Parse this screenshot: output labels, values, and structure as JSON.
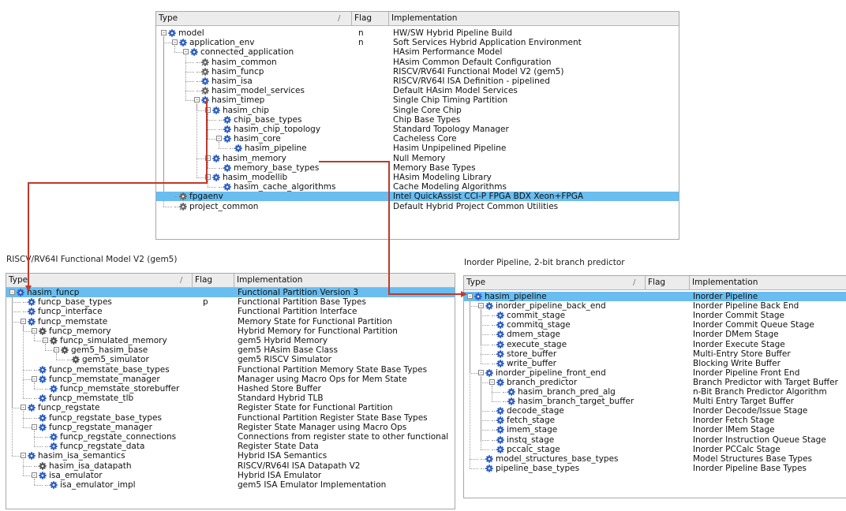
{
  "columns": {
    "type": "Type",
    "flag": "Flag",
    "impl": "Implementation",
    "sort_indicator": "/"
  },
  "colors": {
    "selection": "#69bdf0",
    "arrow": "#c0392b",
    "icon_blue": "#2d5fc4"
  },
  "top_panel": {
    "rows": [
      {
        "depth": 0,
        "icon": "gear-icon",
        "exp": "-",
        "label": "model",
        "flag": "n",
        "impl": "HW/SW Hybrid Pipeline Build"
      },
      {
        "depth": 1,
        "icon": "gear-icon",
        "exp": "-",
        "label": "application_env",
        "flag": "n",
        "impl": "Soft Services Hybrid Application Environment"
      },
      {
        "depth": 2,
        "icon": "gear-icon",
        "exp": "-",
        "label": "connected_application",
        "flag": "",
        "impl": "HAsim Performance Model"
      },
      {
        "depth": 3,
        "icon": "link-gear-icon",
        "exp": "",
        "label": "hasim_common",
        "flag": "",
        "impl": "HAsim Common Default Configuration"
      },
      {
        "depth": 3,
        "icon": "link-gear-icon",
        "exp": "",
        "label": "hasim_funcp",
        "flag": "",
        "impl": "RISCV/RV64I Functional Model V2 (gem5)"
      },
      {
        "depth": 3,
        "icon": "gear-icon",
        "exp": "",
        "label": "hasim_isa",
        "flag": "",
        "impl": "RISCV/RV64I ISA Definition - pipelined"
      },
      {
        "depth": 3,
        "icon": "link-gear-icon",
        "exp": "",
        "label": "hasim_model_services",
        "flag": "",
        "impl": "Default HAsim Model Services"
      },
      {
        "depth": 3,
        "icon": "gear-icon",
        "exp": "-",
        "label": "hasim_timep",
        "flag": "",
        "impl": "Single Chip Timing Partition"
      },
      {
        "depth": 4,
        "icon": "gear-icon",
        "exp": "-",
        "label": "hasim_chip",
        "flag": "",
        "impl": "Single Core Chip"
      },
      {
        "depth": 5,
        "icon": "gear-icon",
        "exp": "",
        "label": "chip_base_types",
        "flag": "",
        "impl": "Chip Base Types"
      },
      {
        "depth": 5,
        "icon": "gear-icon",
        "exp": "",
        "label": "hasim_chip_topology",
        "flag": "",
        "impl": "Standard Topology Manager"
      },
      {
        "depth": 5,
        "icon": "gear-icon",
        "exp": "-",
        "label": "hasim_core",
        "flag": "",
        "impl": "Cacheless Core"
      },
      {
        "depth": 6,
        "icon": "gear-icon",
        "exp": "",
        "label": "hasim_pipeline",
        "flag": "",
        "impl": "Hasim Unpipelined Pipeline"
      },
      {
        "depth": 4,
        "icon": "gear-icon",
        "exp": "-",
        "label": "hasim_memory",
        "flag": "",
        "impl": "Null Memory"
      },
      {
        "depth": 5,
        "icon": "gear-icon",
        "exp": "",
        "label": "memory_base_types",
        "flag": "",
        "impl": "Memory Base Types"
      },
      {
        "depth": 4,
        "icon": "gear-icon",
        "exp": "-",
        "label": "hasim_modellib",
        "flag": "",
        "impl": "HAsim Modeling Library"
      },
      {
        "depth": 5,
        "icon": "gear-icon",
        "exp": "",
        "label": "hasim_cache_algorithms",
        "flag": "",
        "impl": "Cache Modeling Algorithms"
      },
      {
        "depth": 1,
        "icon": "link-gear-icon",
        "exp": "",
        "label": "fpgaenv",
        "flag": "",
        "impl": "Intel QuickAssist CCI-P FPGA BDX Xeon+FPGA",
        "selected": true
      },
      {
        "depth": 1,
        "icon": "link-gear-icon",
        "exp": "",
        "label": "project_common",
        "flag": "",
        "impl": "Default Hybrid Project Common Utilities"
      }
    ]
  },
  "left_panel": {
    "title": "RISCV/RV64I Functional Model V2 (gem5)",
    "rows": [
      {
        "depth": 0,
        "icon": "gear-icon",
        "exp": "-",
        "label": "hasim_funcp",
        "flag": "",
        "impl": "Functional Partition Version 3",
        "selected": true
      },
      {
        "depth": 1,
        "icon": "gear-icon",
        "exp": "",
        "label": "funcp_base_types",
        "flag": "p",
        "impl": "Functional Partition Base Types"
      },
      {
        "depth": 1,
        "icon": "gear-icon",
        "exp": "",
        "label": "funcp_interface",
        "flag": "",
        "impl": "Functional Partition Interface"
      },
      {
        "depth": 1,
        "icon": "gear-icon",
        "exp": "-",
        "label": "funcp_memstate",
        "flag": "",
        "impl": "Memory State for Functional Partition"
      },
      {
        "depth": 2,
        "icon": "gear-dark-icon",
        "exp": "-",
        "label": "funcp_memory",
        "flag": "",
        "impl": "Hybrid Memory for Functional Partition"
      },
      {
        "depth": 3,
        "icon": "gear-dark-icon",
        "exp": "-",
        "label": "funcp_simulated_memory",
        "flag": "",
        "impl": "gem5 Hybrid Memory"
      },
      {
        "depth": 4,
        "icon": "gear-dark-icon",
        "exp": "-",
        "label": "gem5_hasim_base",
        "flag": "",
        "impl": "gem5 HAsim Base Class"
      },
      {
        "depth": 5,
        "icon": "gear-dark-icon",
        "exp": "",
        "label": "gem5_simulator",
        "flag": "",
        "impl": "gem5 RISCV Simulator"
      },
      {
        "depth": 2,
        "icon": "gear-icon",
        "exp": "",
        "label": "funcp_memstate_base_types",
        "flag": "",
        "impl": "Functional Partition Memory State Base Types"
      },
      {
        "depth": 2,
        "icon": "gear-icon",
        "exp": "-",
        "label": "funcp_memstate_manager",
        "flag": "",
        "impl": "Manager using Macro Ops for Mem State"
      },
      {
        "depth": 3,
        "icon": "gear-icon",
        "exp": "",
        "label": "funcp_memstate_storebuffer",
        "flag": "",
        "impl": "Hashed Store Buffer"
      },
      {
        "depth": 2,
        "icon": "gear-icon",
        "exp": "",
        "label": "funcp_memstate_tlb",
        "flag": "",
        "impl": "Standard Hybrid TLB"
      },
      {
        "depth": 1,
        "icon": "gear-icon",
        "exp": "-",
        "label": "funcp_regstate",
        "flag": "",
        "impl": "Register State for Functional Partition"
      },
      {
        "depth": 2,
        "icon": "gear-icon",
        "exp": "",
        "label": "funcp_regstate_base_types",
        "flag": "",
        "impl": "Functional Partition Register State Base Types"
      },
      {
        "depth": 2,
        "icon": "gear-icon",
        "exp": "-",
        "label": "funcp_regstate_manager",
        "flag": "",
        "impl": "Register State Manager using Macro Ops"
      },
      {
        "depth": 3,
        "icon": "gear-icon",
        "exp": "",
        "label": "funcp_regstate_connections",
        "flag": "",
        "impl": "Connections from register state to other functional"
      },
      {
        "depth": 3,
        "icon": "gear-icon",
        "exp": "",
        "label": "funcp_regstate_data",
        "flag": "",
        "impl": "Register State Data"
      },
      {
        "depth": 1,
        "icon": "gear-icon",
        "exp": "-",
        "label": "hasim_isa_semantics",
        "flag": "",
        "impl": "Hybrid ISA Semantics"
      },
      {
        "depth": 2,
        "icon": "gear-dark-icon",
        "exp": "",
        "label": "hasim_isa_datapath",
        "flag": "",
        "impl": "RISCV/RV64I ISA Datapath V2"
      },
      {
        "depth": 2,
        "icon": "gear-icon",
        "exp": "-",
        "label": "isa_emulator",
        "flag": "",
        "impl": "Hybrid ISA Emulator"
      },
      {
        "depth": 3,
        "icon": "gear-icon",
        "exp": "",
        "label": "isa_emulator_impl",
        "flag": "",
        "impl": "gem5 ISA Emulator Implementation"
      }
    ]
  },
  "right_panel": {
    "title": "Inorder Pipeline, 2-bit branch predictor",
    "rows": [
      {
        "depth": 0,
        "icon": "gear-icon",
        "exp": "-",
        "label": "hasim_pipeline",
        "flag": "",
        "impl": "Inorder Pipeline",
        "selected": true
      },
      {
        "depth": 1,
        "icon": "gear-icon",
        "exp": "-",
        "label": "inorder_pipeline_back_end",
        "flag": "",
        "impl": "Inorder Pipeline Back End"
      },
      {
        "depth": 2,
        "icon": "gear-icon",
        "exp": "",
        "label": "commit_stage",
        "flag": "",
        "impl": "Inorder Commit Stage"
      },
      {
        "depth": 2,
        "icon": "gear-icon",
        "exp": "",
        "label": "commitq_stage",
        "flag": "",
        "impl": "Inorder Commit Queue Stage"
      },
      {
        "depth": 2,
        "icon": "gear-icon",
        "exp": "",
        "label": "dmem_stage",
        "flag": "",
        "impl": "Inorder DMem Stage"
      },
      {
        "depth": 2,
        "icon": "gear-icon",
        "exp": "",
        "label": "execute_stage",
        "flag": "",
        "impl": "Inorder Execute Stage"
      },
      {
        "depth": 2,
        "icon": "gear-icon",
        "exp": "",
        "label": "store_buffer",
        "flag": "",
        "impl": "Multi-Entry Store Buffer"
      },
      {
        "depth": 2,
        "icon": "gear-icon",
        "exp": "",
        "label": "write_buffer",
        "flag": "",
        "impl": "Blocking Write Buffer"
      },
      {
        "depth": 1,
        "icon": "gear-icon",
        "exp": "-",
        "label": "inorder_pipeline_front_end",
        "flag": "",
        "impl": "Inorder Pipeline Front End"
      },
      {
        "depth": 2,
        "icon": "gear-icon",
        "exp": "-",
        "label": "branch_predictor",
        "flag": "",
        "impl": "Branch Predictor with Target Buffer"
      },
      {
        "depth": 3,
        "icon": "gear-icon",
        "exp": "",
        "label": "hasim_branch_pred_alg",
        "flag": "",
        "impl": "n-Bit Branch Predictor Algorithm"
      },
      {
        "depth": 3,
        "icon": "gear-icon",
        "exp": "",
        "label": "hasim_branch_target_buffer",
        "flag": "",
        "impl": "Multi Entry Target Buffer"
      },
      {
        "depth": 2,
        "icon": "gear-icon",
        "exp": "",
        "label": "decode_stage",
        "flag": "",
        "impl": "Inorder Decode/Issue Stage"
      },
      {
        "depth": 2,
        "icon": "gear-icon",
        "exp": "",
        "label": "fetch_stage",
        "flag": "",
        "impl": "Inorder Fetch Stage"
      },
      {
        "depth": 2,
        "icon": "gear-icon",
        "exp": "",
        "label": "imem_stage",
        "flag": "",
        "impl": "Inorder IMem Stage"
      },
      {
        "depth": 2,
        "icon": "gear-icon",
        "exp": "",
        "label": "instq_stage",
        "flag": "",
        "impl": "Inorder Instruction Queue Stage"
      },
      {
        "depth": 2,
        "icon": "gear-icon",
        "exp": "",
        "label": "pccalc_stage",
        "flag": "",
        "impl": "Inorder PCCalc Stage"
      },
      {
        "depth": 1,
        "icon": "gear-icon",
        "exp": "",
        "label": "model_structures_base_types",
        "flag": "",
        "impl": "Model Structures Base Types"
      },
      {
        "depth": 1,
        "icon": "gear-icon",
        "exp": "",
        "label": "pipeline_base_types",
        "flag": "",
        "impl": "Inorder Pipeline Base Types"
      }
    ]
  }
}
